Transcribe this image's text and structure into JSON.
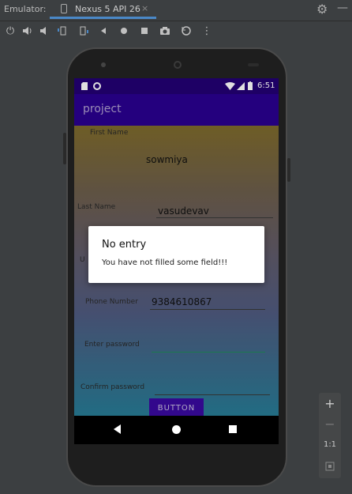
{
  "window": {
    "emulator_label": "Emulator:",
    "tab_label": "Nexus 5 API 26",
    "tab_close": "×",
    "settings_icon": "gear-icon",
    "minimize_icon": "dash-icon"
  },
  "toolbar": {
    "icons": [
      "power-icon",
      "volume-up-icon",
      "volume-down-icon",
      "rotate-left-icon",
      "rotate-right-icon",
      "back-icon",
      "home-icon",
      "overview-icon",
      "camera-icon",
      "replay-icon",
      "more-icon"
    ]
  },
  "device": {
    "status_time": "6:51",
    "app_title": "project",
    "form": {
      "first_name_label": "First Name",
      "first_name_value": "sowmiya",
      "last_name_label": "Last Name",
      "last_name_value": "vasudevav",
      "username_label_partial": "U",
      "phone_label": "Phone Number",
      "phone_value": "9384610867",
      "password_label": "Enter password",
      "confirm_label": "Confirm password",
      "button_label": "BUTTON"
    },
    "dialog": {
      "title": "No entry",
      "message": "You have not filled some field!!!"
    }
  },
  "zoom": {
    "plus": "+",
    "minus": "−",
    "ratio": "1:1"
  },
  "colors": {
    "status_bar": "#230073",
    "app_bar": "#2a0090",
    "button": "#3a0aa0",
    "password_underline": "#1f8a5a"
  }
}
